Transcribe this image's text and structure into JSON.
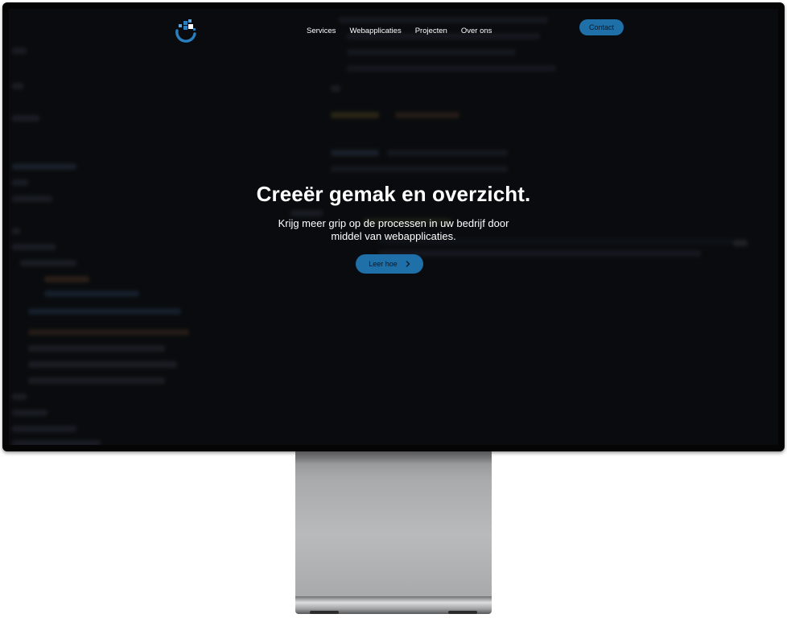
{
  "nav": {
    "items": [
      "Services",
      "Webapplicaties",
      "Projecten",
      "Over ons"
    ],
    "contact_label": "Contact"
  },
  "hero": {
    "title": "Creeër gemak en overzicht.",
    "subtitle_line1": "Krijg meer grip op de processen in uw bedrijf door",
    "subtitle_line2": "middel van webapplicaties.",
    "cta_label": "Leer hoe"
  },
  "colors": {
    "accent": "#1f6fa8",
    "screen_bg": "#0d0f12",
    "bezel": "#050505",
    "stand": "#b9babc"
  },
  "icons": {
    "logo": "logo-icon",
    "cta_arrow": "chevron-right-icon"
  }
}
